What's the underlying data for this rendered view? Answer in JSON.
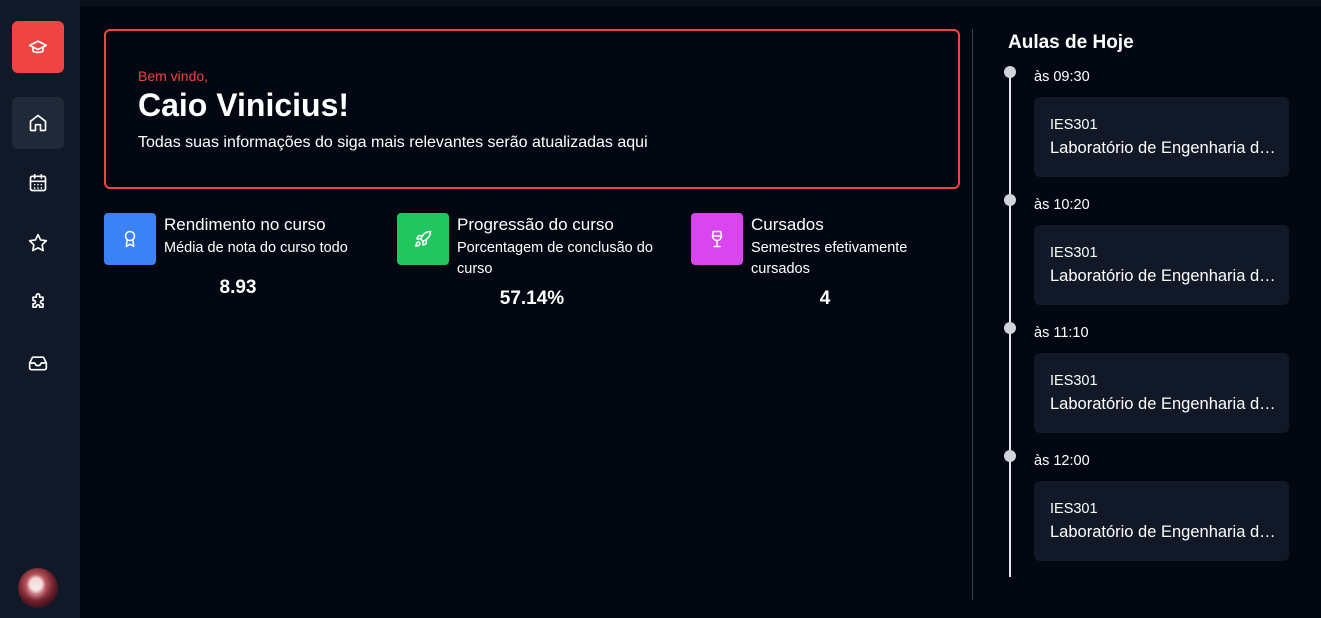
{
  "welcome": {
    "greeting": "Bem vindo,",
    "name": "Caio Vinicius!",
    "description": "Todas suas informações do siga mais relevantes serão atualizadas aqui"
  },
  "stats": [
    {
      "title": "Rendimento no curso",
      "description": "Média de nota do curso todo",
      "value": "8.93",
      "icon": "award-icon",
      "color": "#3b82f6"
    },
    {
      "title": "Progressão do curso",
      "description": "Porcentagem de conclusão do curso",
      "value": "57.14%",
      "icon": "rocket-icon",
      "color": "#22c55e"
    },
    {
      "title": "Cursados",
      "description": "Semestres efetivamente cursados",
      "value": "4",
      "icon": "wine-glass-icon",
      "color": "#d946ef"
    }
  ],
  "today": {
    "title": "Aulas de Hoje",
    "classes": [
      {
        "time": "às 09:30",
        "code": "IES301",
        "name": "Laboratório de Engenharia de Software"
      },
      {
        "time": "às 10:20",
        "code": "IES301",
        "name": "Laboratório de Engenharia de Software"
      },
      {
        "time": "às 11:10",
        "code": "IES301",
        "name": "Laboratório de Engenharia de Software"
      },
      {
        "time": "às 12:00",
        "code": "IES301",
        "name": "Laboratório de Engenharia de Software"
      }
    ]
  },
  "sidebar": {
    "logo_icon": "graduation-cap-icon",
    "items": [
      {
        "icon": "home-icon",
        "active": true
      },
      {
        "icon": "calendar-icon",
        "active": false
      },
      {
        "icon": "star-icon",
        "active": false
      },
      {
        "icon": "puzzle-icon",
        "active": false
      },
      {
        "icon": "inbox-icon",
        "active": false
      }
    ]
  },
  "colors": {
    "accent": "#ef4444",
    "background": "#030712",
    "sidebar": "#111827",
    "card": "#111827"
  }
}
